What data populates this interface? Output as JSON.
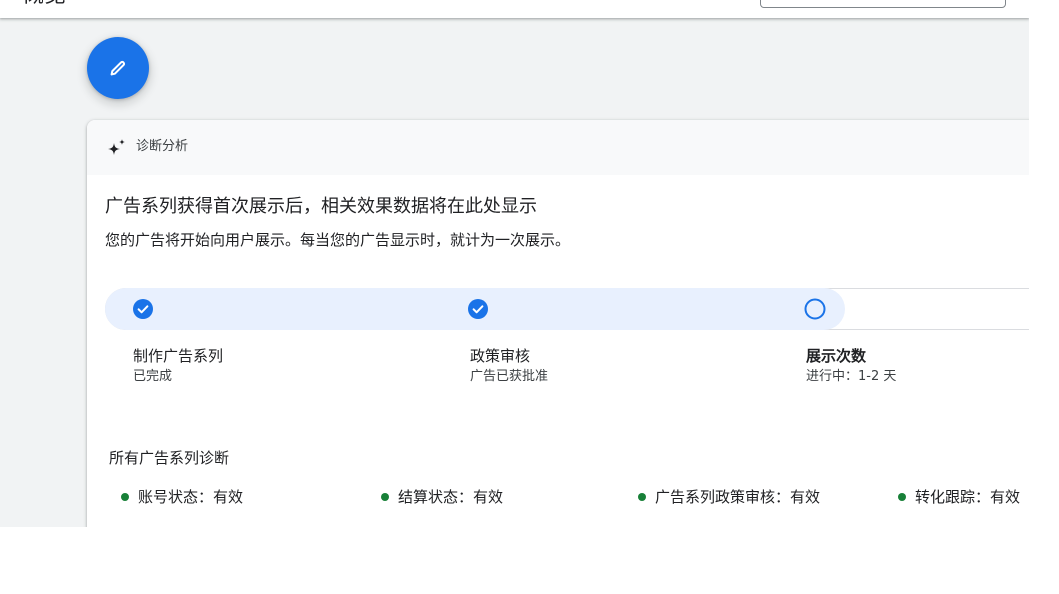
{
  "header": {
    "title": "概览"
  },
  "fab": {
    "icon": "pencil-icon"
  },
  "diagnostics_card": {
    "header_icon": "sparkle-icon",
    "header_title": "诊断分析",
    "headline": "广告系列获得首次展示后，相关效果数据将在此处显示",
    "description": "您的广告将开始向用户展示。每当您的广告显示时，就计为一次展示。",
    "steps": [
      {
        "title": "制作广告系列",
        "status_text": "已完成",
        "done": true,
        "icon": "check-circle-icon"
      },
      {
        "title": "政策审核",
        "status_text": "广告已获批准",
        "done": true,
        "icon": "check-circle-icon"
      },
      {
        "title": "展示次数",
        "status_text": "进行中：1-2 天",
        "done": false,
        "icon": "empty-circle-icon"
      }
    ],
    "all_diagnostics_title": "所有广告系列诊断",
    "statuses": [
      {
        "label": "账号状态：有效"
      },
      {
        "label": "结算状态：有效"
      },
      {
        "label": "广告系列政策审核：有效"
      },
      {
        "label": "转化跟踪：有效"
      }
    ]
  },
  "colors": {
    "accent": "#1a73e8",
    "progress_fill": "#e8f0fe",
    "ok": "#188038",
    "page_background": "#f1f3f4",
    "text": "#202124"
  }
}
